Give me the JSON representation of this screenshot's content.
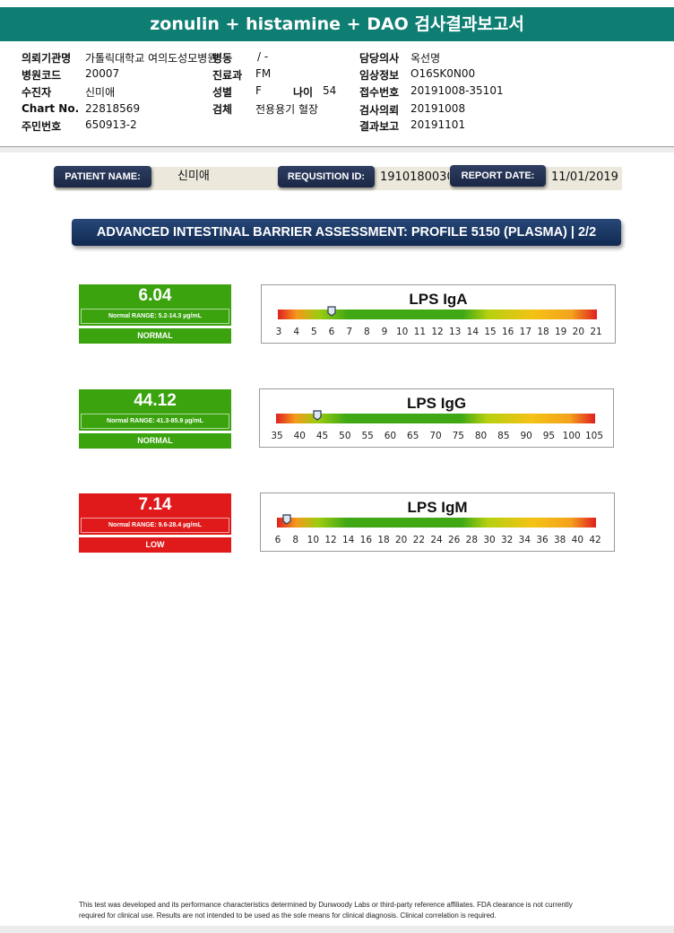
{
  "report_title": "zonulin + histamine + DAO 검사결과보고서",
  "header": {
    "institution_label": "의뢰기관명",
    "institution_value": "가톨릭대학교 여의도성모병원",
    "ward_label": "병동",
    "ward_value": "/ -",
    "doctor_label": "담당의사",
    "doctor_value": "옥선명",
    "hospital_code_label": "병원코드",
    "hospital_code_value": "20007",
    "dept_label": "진료과",
    "dept_value": "FM",
    "clinical_info_label": "임상정보",
    "clinical_info_value": "O16SK0N00",
    "patient_label": "수진자",
    "patient_value": "신미애",
    "sex_label": "성별",
    "sex_value": "F",
    "age_label": "나이",
    "age_value": "54",
    "receipt_label": "접수번호",
    "receipt_value": "20191008-35101",
    "chart_label": "Chart No.",
    "chart_value": "22818569",
    "specimen_label": "검체",
    "specimen_value": "전용용기 혈장",
    "request_label": "검사의뢰",
    "request_value": "20191008",
    "id_label": "주민번호",
    "id_value": "650913-2",
    "report_label": "결과보고",
    "report_value": "20191101"
  },
  "patient_strip": {
    "patient_name_label": "PATIENT NAME:",
    "patient_name": "신미애",
    "requisition_label": "REQUSITION ID:",
    "requisition_id": "1910180030",
    "report_date_label": "REPORT DATE:",
    "report_date": "11/01/2019"
  },
  "section_title": "ADVANCED INTESTINAL BARRIER ASSESSMENT: PROFILE 5150 (PLASMA) | 2/2",
  "colors": {
    "normal": "#3aa30e",
    "low": "#e01a1a",
    "header_teal": "#0e7e73",
    "navy": "#1a2745"
  },
  "tests": [
    {
      "name": "LPS IgA",
      "value": "6.04",
      "value_num": 6.04,
      "range": "Normal RANGE: 5.2-14.3 µg/mL",
      "status": "NORMAL",
      "status_color": "green",
      "scale_min": 3,
      "scale_max": 21,
      "ticks": [
        "3",
        "4",
        "5",
        "6",
        "7",
        "8",
        "9",
        "10",
        "11",
        "12",
        "13",
        "14",
        "15",
        "16",
        "17",
        "18",
        "19",
        "20",
        "21"
      ]
    },
    {
      "name": "LPS IgG",
      "value": "44.12",
      "value_num": 44.12,
      "range": "Normal RANGE: 41.3-85.9 µg/mL",
      "status": "NORMAL",
      "status_color": "green",
      "scale_min": 35,
      "scale_max": 105,
      "ticks": [
        "35",
        "40",
        "45",
        "50",
        "55",
        "60",
        "65",
        "70",
        "75",
        "80",
        "85",
        "90",
        "95",
        "100",
        "105"
      ]
    },
    {
      "name": "LPS IgM",
      "value": "7.14",
      "value_num": 7.14,
      "range": "Normal RANGE: 9.6-28.4 µg/mL",
      "status": "LOW",
      "status_color": "red",
      "scale_min": 6,
      "scale_max": 42,
      "ticks": [
        "6",
        "8",
        "10",
        "12",
        "14",
        "16",
        "18",
        "20",
        "22",
        "24",
        "26",
        "28",
        "30",
        "32",
        "34",
        "36",
        "38",
        "40",
        "42"
      ]
    }
  ],
  "footer": "This test was developed and its performance characteristics determined by Dunwoody Labs or third-party reference affiliates. FDA clearance is not currently required for clinical use. Results are not intended to be used as the sole means for clinical diagnosis. Clinical correlation is required."
}
